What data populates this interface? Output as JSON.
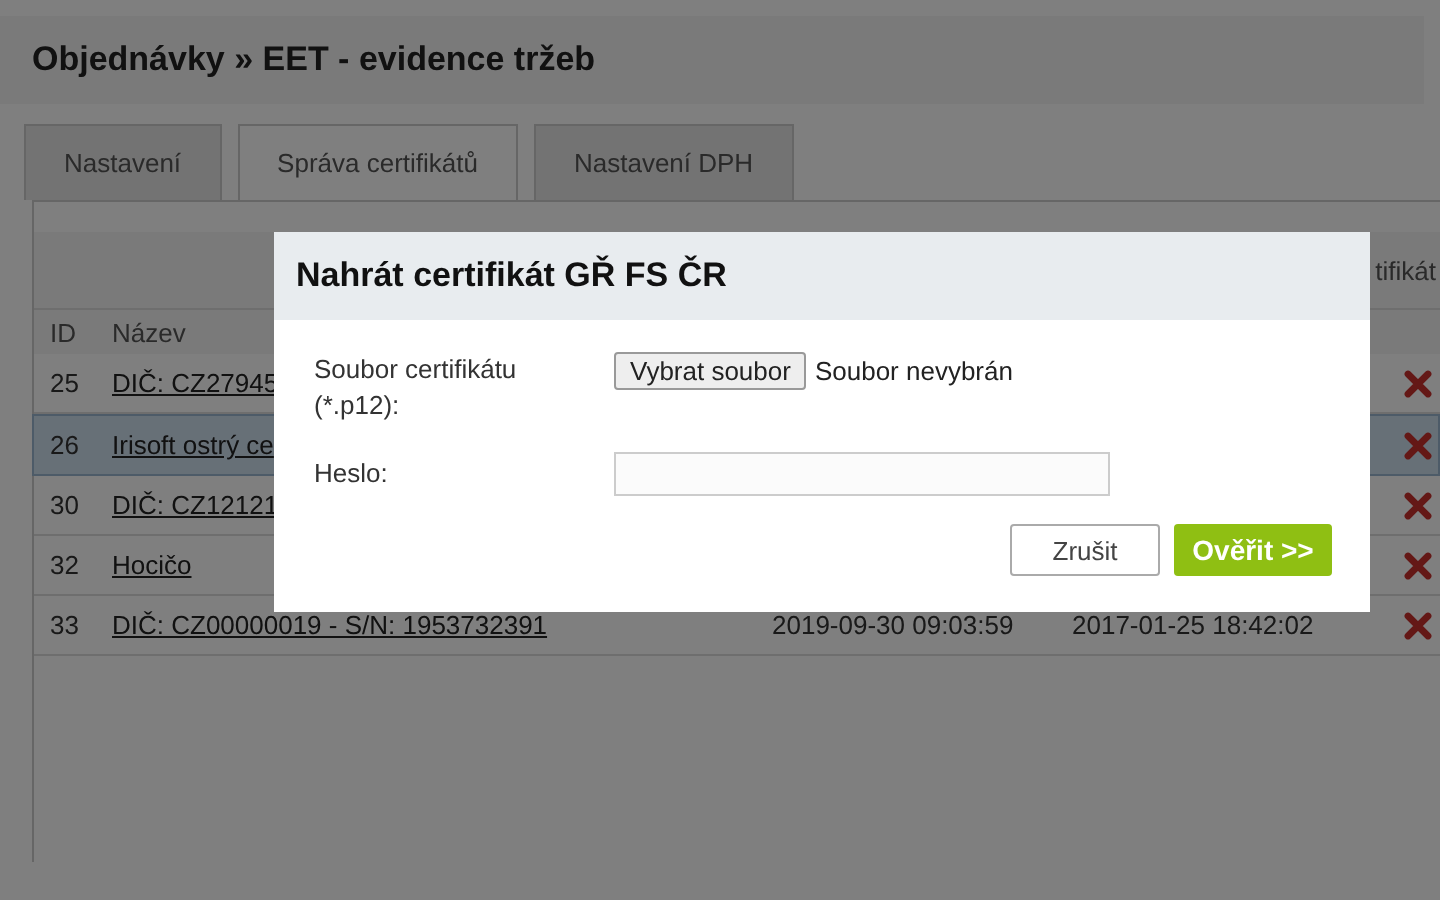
{
  "page_title": "Objednávky » EET - evidence tržeb",
  "tabs": [
    {
      "label": "Nastavení",
      "selected": false
    },
    {
      "label": "Správa certifikátů",
      "selected": true
    },
    {
      "label": "Nastavení DPH",
      "selected": false
    }
  ],
  "table": {
    "top_header": "tifikát",
    "columns": [
      "ID",
      "Název"
    ],
    "rows": [
      {
        "id": "25",
        "name": "DIČ: CZ27945",
        "column_3": "",
        "column_4": "",
        "selected": false
      },
      {
        "id": "26",
        "name": "Irisoft ostrý ce",
        "column_3": "",
        "column_4": "",
        "selected": true
      },
      {
        "id": "30",
        "name": "DIČ: CZ12121",
        "column_3": "",
        "column_4": "",
        "selected": false
      },
      {
        "id": "32",
        "name": "Hocičo",
        "column_3": "",
        "column_4": "",
        "selected": false
      },
      {
        "id": "33",
        "name": "DIČ: CZ00000019 - S/N: 1953732391",
        "column_3": "2019-09-30 09:03:59",
        "column_4": "2017-01-25 18:42:02",
        "selected": false
      }
    ]
  },
  "dialog": {
    "title": "Nahrát certifikát GŘ FS ČR",
    "file_label": "Soubor certifikátu (*.p12):",
    "file_button": "Vybrat soubor",
    "file_status": "Soubor nevybrán",
    "password_label": "Heslo:",
    "cancel_button": "Zrušit",
    "confirm_button": "Ověřit >>"
  }
}
